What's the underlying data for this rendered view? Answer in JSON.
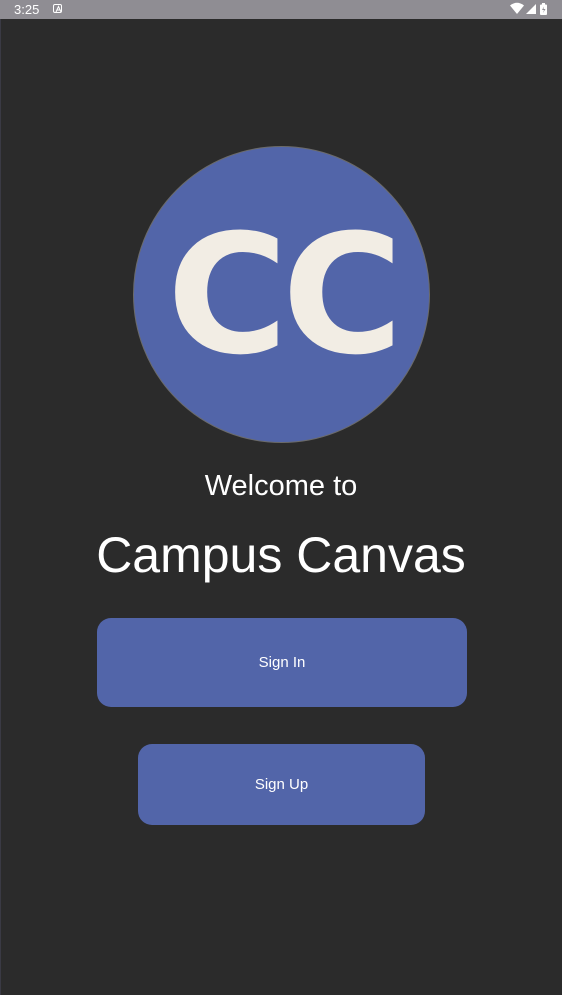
{
  "status_bar": {
    "time": "3:25",
    "notification_icon": "text-a-icon",
    "icons": [
      "wifi-icon",
      "signal-icon",
      "battery-icon"
    ]
  },
  "logo": {
    "text": "CC",
    "circle_color": "#5265a9",
    "letter_color": "#f2ede4"
  },
  "welcome": {
    "line1": "Welcome to",
    "app_name": "Campus Canvas"
  },
  "buttons": {
    "sign_in": "Sign In",
    "sign_up": "Sign Up"
  },
  "colors": {
    "background": "#2b2b2b",
    "accent": "#5265a9",
    "status_bar": "#8f8d93"
  }
}
